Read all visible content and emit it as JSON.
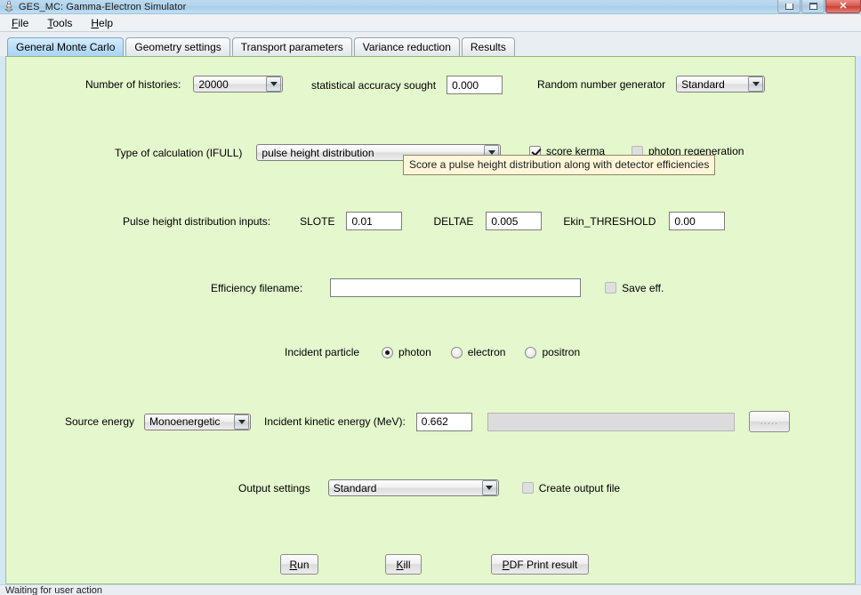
{
  "window": {
    "title": "GES_MC: Gamma-Electron Simulator",
    "icon": "app-icon",
    "buttons": {
      "minimize": "minimize",
      "maximize": "maximize",
      "close": "close"
    }
  },
  "menubar": {
    "items": [
      {
        "label": "File",
        "mnemonic": "F"
      },
      {
        "label": "Tools",
        "mnemonic": "T"
      },
      {
        "label": "Help",
        "mnemonic": "H"
      }
    ]
  },
  "tabs": [
    {
      "label": "General Monte Carlo",
      "active": true
    },
    {
      "label": "Geometry settings",
      "active": false
    },
    {
      "label": "Transport parameters",
      "active": false
    },
    {
      "label": "Variance reduction",
      "active": false
    },
    {
      "label": "Results",
      "active": false
    }
  ],
  "form": {
    "histories_label": "Number of histories:",
    "histories_value": "20000",
    "accuracy_label": "statistical accuracy sought",
    "accuracy_value": "0.000",
    "rng_label": "Random number generator",
    "rng_value": "Standard",
    "ifull_label": "Type of calculation (IFULL)",
    "ifull_value": "pulse height distribution",
    "score_kerma_label": "score kerma",
    "photon_regen_label": "photon regeneration",
    "tooltip_text": "Score a pulse height distribution along with detector efficiencies",
    "phd_inputs_label": "Pulse height distribution inputs:",
    "slote_label": "SLOTE",
    "slote_value": "0.01",
    "deltae_label": "DELTAE",
    "deltae_value": "0.005",
    "ekin_threshold_label": "Ekin_THRESHOLD",
    "ekin_threshold_value": "0.00",
    "efficiency_filename_label": "Efficiency filename:",
    "efficiency_filename_value": "",
    "save_eff_label": "Save eff.",
    "incident_particle_label": "Incident particle",
    "particles": [
      {
        "label": "photon",
        "selected": true
      },
      {
        "label": "electron",
        "selected": false
      },
      {
        "label": "positron",
        "selected": false
      }
    ],
    "source_energy_label": "Source energy",
    "source_energy_value": "Monoenergetic",
    "kinetic_energy_label": "Incident kinetic energy (MeV):",
    "kinetic_energy_value": "0.662",
    "spectrum_file_value": "",
    "browse_button_label": ".....",
    "output_settings_label": "Output settings",
    "output_settings_value": "Standard",
    "create_output_file_label": "Create output file"
  },
  "actions": {
    "run_label": "Run",
    "run_mnemonic": "R",
    "kill_label": "Kill",
    "kill_mnemonic": "K",
    "pdf_label": "PDF Print result",
    "pdf_mnemonic": "P"
  },
  "statusbar": {
    "text": "Waiting for user action"
  },
  "colors": {
    "panel_bg": "#e4f7cd",
    "tooltip_bg": "#fdf6d8",
    "active_tab": "#bbdff7",
    "close_button": "#d9554c"
  }
}
